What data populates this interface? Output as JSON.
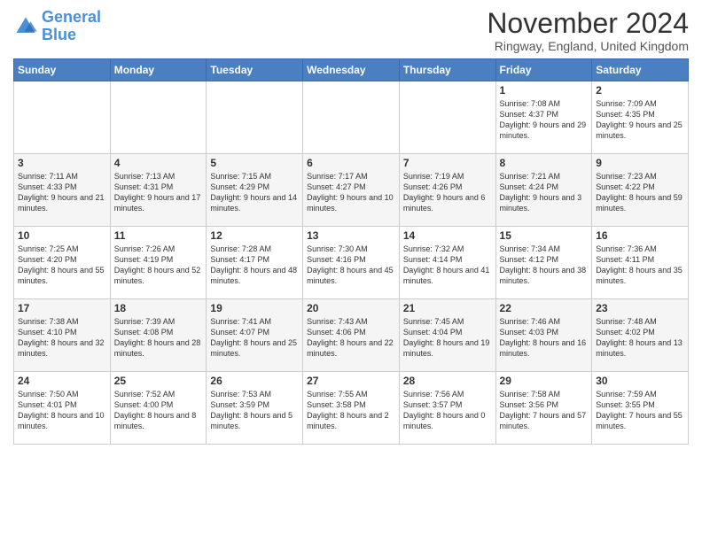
{
  "logo": {
    "line1": "General",
    "line2": "Blue"
  },
  "header": {
    "month": "November 2024",
    "location": "Ringway, England, United Kingdom"
  },
  "weekdays": [
    "Sunday",
    "Monday",
    "Tuesday",
    "Wednesday",
    "Thursday",
    "Friday",
    "Saturday"
  ],
  "weeks": [
    [
      {
        "day": "",
        "info": ""
      },
      {
        "day": "",
        "info": ""
      },
      {
        "day": "",
        "info": ""
      },
      {
        "day": "",
        "info": ""
      },
      {
        "day": "",
        "info": ""
      },
      {
        "day": "1",
        "info": "Sunrise: 7:08 AM\nSunset: 4:37 PM\nDaylight: 9 hours and 29 minutes."
      },
      {
        "day": "2",
        "info": "Sunrise: 7:09 AM\nSunset: 4:35 PM\nDaylight: 9 hours and 25 minutes."
      }
    ],
    [
      {
        "day": "3",
        "info": "Sunrise: 7:11 AM\nSunset: 4:33 PM\nDaylight: 9 hours and 21 minutes."
      },
      {
        "day": "4",
        "info": "Sunrise: 7:13 AM\nSunset: 4:31 PM\nDaylight: 9 hours and 17 minutes."
      },
      {
        "day": "5",
        "info": "Sunrise: 7:15 AM\nSunset: 4:29 PM\nDaylight: 9 hours and 14 minutes."
      },
      {
        "day": "6",
        "info": "Sunrise: 7:17 AM\nSunset: 4:27 PM\nDaylight: 9 hours and 10 minutes."
      },
      {
        "day": "7",
        "info": "Sunrise: 7:19 AM\nSunset: 4:26 PM\nDaylight: 9 hours and 6 minutes."
      },
      {
        "day": "8",
        "info": "Sunrise: 7:21 AM\nSunset: 4:24 PM\nDaylight: 9 hours and 3 minutes."
      },
      {
        "day": "9",
        "info": "Sunrise: 7:23 AM\nSunset: 4:22 PM\nDaylight: 8 hours and 59 minutes."
      }
    ],
    [
      {
        "day": "10",
        "info": "Sunrise: 7:25 AM\nSunset: 4:20 PM\nDaylight: 8 hours and 55 minutes."
      },
      {
        "day": "11",
        "info": "Sunrise: 7:26 AM\nSunset: 4:19 PM\nDaylight: 8 hours and 52 minutes."
      },
      {
        "day": "12",
        "info": "Sunrise: 7:28 AM\nSunset: 4:17 PM\nDaylight: 8 hours and 48 minutes."
      },
      {
        "day": "13",
        "info": "Sunrise: 7:30 AM\nSunset: 4:16 PM\nDaylight: 8 hours and 45 minutes."
      },
      {
        "day": "14",
        "info": "Sunrise: 7:32 AM\nSunset: 4:14 PM\nDaylight: 8 hours and 41 minutes."
      },
      {
        "day": "15",
        "info": "Sunrise: 7:34 AM\nSunset: 4:12 PM\nDaylight: 8 hours and 38 minutes."
      },
      {
        "day": "16",
        "info": "Sunrise: 7:36 AM\nSunset: 4:11 PM\nDaylight: 8 hours and 35 minutes."
      }
    ],
    [
      {
        "day": "17",
        "info": "Sunrise: 7:38 AM\nSunset: 4:10 PM\nDaylight: 8 hours and 32 minutes."
      },
      {
        "day": "18",
        "info": "Sunrise: 7:39 AM\nSunset: 4:08 PM\nDaylight: 8 hours and 28 minutes."
      },
      {
        "day": "19",
        "info": "Sunrise: 7:41 AM\nSunset: 4:07 PM\nDaylight: 8 hours and 25 minutes."
      },
      {
        "day": "20",
        "info": "Sunrise: 7:43 AM\nSunset: 4:06 PM\nDaylight: 8 hours and 22 minutes."
      },
      {
        "day": "21",
        "info": "Sunrise: 7:45 AM\nSunset: 4:04 PM\nDaylight: 8 hours and 19 minutes."
      },
      {
        "day": "22",
        "info": "Sunrise: 7:46 AM\nSunset: 4:03 PM\nDaylight: 8 hours and 16 minutes."
      },
      {
        "day": "23",
        "info": "Sunrise: 7:48 AM\nSunset: 4:02 PM\nDaylight: 8 hours and 13 minutes."
      }
    ],
    [
      {
        "day": "24",
        "info": "Sunrise: 7:50 AM\nSunset: 4:01 PM\nDaylight: 8 hours and 10 minutes."
      },
      {
        "day": "25",
        "info": "Sunrise: 7:52 AM\nSunset: 4:00 PM\nDaylight: 8 hours and 8 minutes."
      },
      {
        "day": "26",
        "info": "Sunrise: 7:53 AM\nSunset: 3:59 PM\nDaylight: 8 hours and 5 minutes."
      },
      {
        "day": "27",
        "info": "Sunrise: 7:55 AM\nSunset: 3:58 PM\nDaylight: 8 hours and 2 minutes."
      },
      {
        "day": "28",
        "info": "Sunrise: 7:56 AM\nSunset: 3:57 PM\nDaylight: 8 hours and 0 minutes."
      },
      {
        "day": "29",
        "info": "Sunrise: 7:58 AM\nSunset: 3:56 PM\nDaylight: 7 hours and 57 minutes."
      },
      {
        "day": "30",
        "info": "Sunrise: 7:59 AM\nSunset: 3:55 PM\nDaylight: 7 hours and 55 minutes."
      }
    ]
  ]
}
